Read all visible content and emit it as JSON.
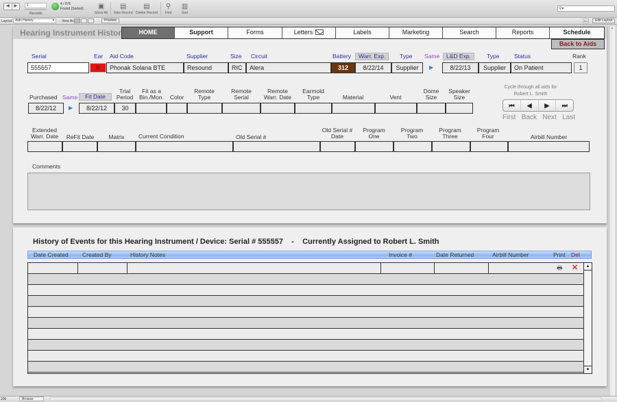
{
  "toolbar": {
    "record_number": "1",
    "records_label": "Records",
    "found_count": "4 / 876",
    "found_label": "Found (Sorted)",
    "buttons": [
      {
        "label": "Show All",
        "icon": "show-all-icon"
      },
      {
        "label": "New Record",
        "icon": "new-record-icon"
      },
      {
        "label": "Delete Record",
        "icon": "delete-record-icon"
      },
      {
        "label": "Find",
        "icon": "find-icon"
      },
      {
        "label": "Sort",
        "icon": "sort-icon"
      }
    ],
    "search_placeholder": ""
  },
  "layoutbar": {
    "layout_label": "Layout:",
    "layout_value": "Aids History",
    "view_as_label": "View As:",
    "preview_label": "Preview",
    "aa_label": "A/a",
    "edit_layout_label": "Edit Layout"
  },
  "header": {
    "title": "Hearing Instrument History",
    "tabs": [
      {
        "label": "HOME",
        "active": true
      },
      {
        "label": "Support"
      },
      {
        "label": "Forms"
      },
      {
        "label": "Letters"
      },
      {
        "label": "Labels"
      },
      {
        "label": "Marketing"
      },
      {
        "label": "Search"
      },
      {
        "label": "Reports"
      },
      {
        "label": "Schedule"
      }
    ],
    "back_button": "Back to Aids"
  },
  "row1": {
    "labels": {
      "serial": "Serial",
      "ear": "Ear",
      "aid_code": "Aid Code",
      "supplier": "Supplier",
      "size": "Size",
      "circuit": "Circuit",
      "battery": "Battery",
      "warr_exp": "Warr. Exp.",
      "type": "Type",
      "same": "Same",
      "ld_exp": "L&D  Exp.",
      "type2": "Type",
      "status": "Status",
      "rank": "Rank"
    },
    "values": {
      "serial": "555557",
      "ear": "R",
      "aid_code": "Phonak Solana BTE",
      "supplier": "Resound",
      "size": "RIC",
      "circuit": "Alera",
      "battery": "312",
      "warr_exp": "8/22/14",
      "type": "Supplier",
      "ld_exp": "8/22/13",
      "type2": "Supplier",
      "status": "On Patient",
      "rank": "1"
    }
  },
  "row2": {
    "labels": {
      "purchased": "Purchased",
      "same": "Same",
      "fit_date": "Fit Date",
      "trial_period": "Trial\nPeriod",
      "fit_as": "Fit as a\nBin./Mon.",
      "color": "Color",
      "remote_type": "Remote\nType",
      "remote_serial": "Remote\nSerial",
      "remote_warr": "Remote\nWarr. Date",
      "earmold_type": "Earmold\nType",
      "material": "Material",
      "vent": "Vent",
      "dome_size": "Dome\nSize",
      "speaker_size": "Speaker\nSize"
    },
    "values": {
      "purchased": "8/22/12",
      "fit_date": "8/22/12",
      "trial_period": "30",
      "fit_as": "",
      "color": "",
      "remote_type": "",
      "remote_serial": "",
      "remote_warr": "",
      "earmold_type": "",
      "material": "",
      "vent": "",
      "dome_size": "",
      "speaker_size": ""
    }
  },
  "cycle": {
    "text": "Cycle through all aids for\nRobert L. Smith",
    "buttons": [
      "First",
      "Back",
      "Next",
      "Last"
    ]
  },
  "row3": {
    "labels": {
      "ext_warr": "Extended\nWarr. Date",
      "refit": "ReFit Date",
      "matrix": "Matrix",
      "condition": "Current Condition",
      "old_serial": "Old Serial #",
      "old_serial_date": "Old Serial #\nDate",
      "prog1": "Program\nOne",
      "prog2": "Program\nTwo",
      "prog3": "Program\nThree",
      "prog4": "Program\nFour",
      "airbill": "Airbill Number"
    }
  },
  "comments": {
    "label": "Comments",
    "value": ""
  },
  "history": {
    "title": "History of Events for this Hearing Instrument / Device: Serial # 555557    -    Currently Assigned to Robert L. Smith",
    "columns": [
      "Date Created",
      "Created By",
      "History Notes",
      "Invoice #",
      "Date Returned",
      "Airbill Number",
      "Print",
      "Del"
    ],
    "row_count": 10
  },
  "statusbar": {
    "zoom": "200",
    "mode": "Browse"
  }
}
